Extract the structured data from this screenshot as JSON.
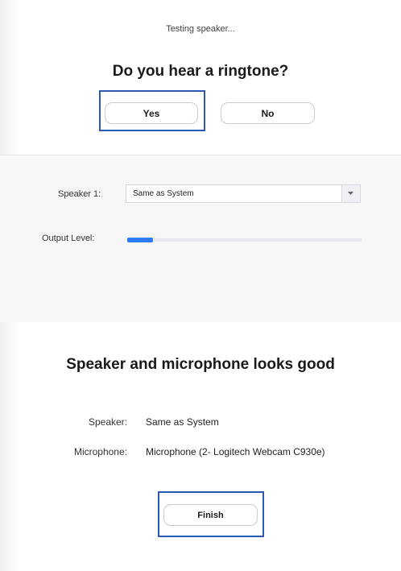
{
  "speaker_test": {
    "status": "Testing speaker...",
    "question": "Do you hear a ringtone?",
    "yes_label": "Yes",
    "no_label": "No"
  },
  "speaker_settings": {
    "speaker_label": "Speaker 1:",
    "speaker_selected": "Same as System",
    "output_level_label": "Output Level:",
    "output_level_fraction": 0.11
  },
  "result": {
    "title": "Speaker and microphone looks good",
    "speaker_key": "Speaker:",
    "speaker_value": "Same as System",
    "microphone_key": "Microphone:",
    "microphone_value": "Microphone (2- Logitech Webcam C930e)",
    "finish_label": "Finish"
  },
  "colors": {
    "highlight": "#2a5ab3",
    "level_fill": "#2d7cf0"
  },
  "icons": {
    "dropdown": "chevron-down-icon"
  }
}
